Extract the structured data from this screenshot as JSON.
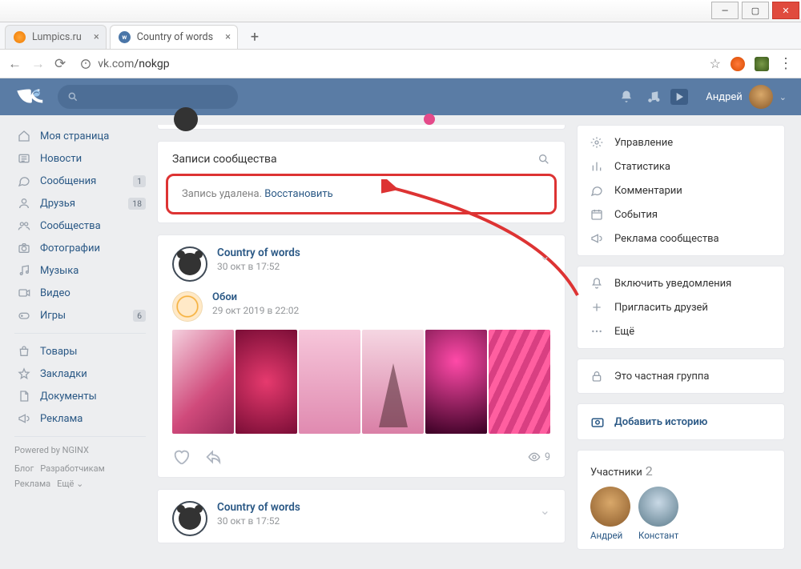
{
  "window": {
    "minimize": "—"
  },
  "tabs": {
    "items": [
      {
        "title": "Lumpics.ru"
      },
      {
        "title": "Country of words"
      }
    ]
  },
  "address": {
    "host": "vk.com",
    "path": "/nokgp"
  },
  "vk_header": {
    "user_name": "Андрей"
  },
  "left_nav": {
    "items": [
      {
        "label": "Моя страница",
        "icon": "home-icon"
      },
      {
        "label": "Новости",
        "icon": "news-icon"
      },
      {
        "label": "Сообщения",
        "icon": "message-icon",
        "badge": "1"
      },
      {
        "label": "Друзья",
        "icon": "friends-icon",
        "badge": "18"
      },
      {
        "label": "Сообщества",
        "icon": "groups-icon"
      },
      {
        "label": "Фотографии",
        "icon": "camera-icon"
      },
      {
        "label": "Музыка",
        "icon": "music-icon"
      },
      {
        "label": "Видео",
        "icon": "video-icon"
      },
      {
        "label": "Игры",
        "icon": "games-icon",
        "badge": "6"
      }
    ],
    "items2": [
      {
        "label": "Товары",
        "icon": "market-icon"
      },
      {
        "label": "Закладки",
        "icon": "star-icon"
      },
      {
        "label": "Документы",
        "icon": "docs-icon"
      },
      {
        "label": "Реклама",
        "icon": "ads-icon"
      }
    ],
    "powered": "Powered by NGINX",
    "foot": {
      "blog": "Блог",
      "dev": "Разработчикам",
      "ads": "Реклама",
      "more": "Ещё ⌄"
    }
  },
  "wall": {
    "header": "Записи сообщества",
    "deleted_text": "Запись удалена. ",
    "restore": "Восстановить",
    "post1": {
      "author": "Country of words",
      "date": "30 окт в 17:52",
      "repost_author": "Обои",
      "repost_date": "29 окт 2019 в 22:02",
      "views": "9"
    },
    "post2": {
      "author": "Country of words",
      "date": "30 окт в 17:52"
    }
  },
  "right": {
    "manage": [
      {
        "label": "Управление",
        "icon": "gear-icon"
      },
      {
        "label": "Статистика",
        "icon": "stats-icon"
      },
      {
        "label": "Комментарии",
        "icon": "comment-icon"
      },
      {
        "label": "События",
        "icon": "calendar-icon"
      },
      {
        "label": "Реклама сообщества",
        "icon": "megaphone-icon"
      }
    ],
    "actions": [
      {
        "label": "Включить уведомления",
        "icon": "bell-icon"
      },
      {
        "label": "Пригласить друзей",
        "icon": "plus-icon"
      },
      {
        "label": "Ещё",
        "icon": "dots-icon"
      }
    ],
    "private": "Это частная группа",
    "add_story": "Добавить историю",
    "members_title": "Участники",
    "members_count": "2",
    "member_names": [
      "Андрей",
      "Константин"
    ]
  }
}
